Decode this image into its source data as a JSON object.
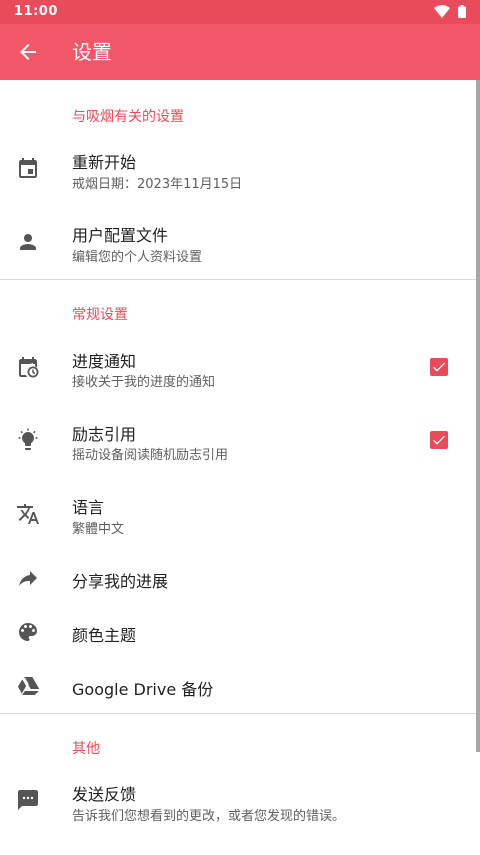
{
  "status_bar": {
    "time": "11:00"
  },
  "app_bar": {
    "title": "设置"
  },
  "colors": {
    "accent": "#e84c5a",
    "toolbar": "#f25767",
    "status_bar": "#e84c5a"
  },
  "sections": {
    "smoking": {
      "header": "与吸烟有关的设置",
      "restart": {
        "title": "重新开始",
        "subtitle": "戒烟日期：2023年11月15日",
        "icon": "calendar-icon"
      },
      "profile": {
        "title": "用户配置文件",
        "subtitle": "编辑您的个人资料设置",
        "icon": "person-icon"
      }
    },
    "general": {
      "header": "常规设置",
      "progress_notification": {
        "title": "进度通知",
        "subtitle": "接收关于我的进度的通知",
        "checked": true,
        "icon": "calendar-clock-icon"
      },
      "motivational_quotes": {
        "title": "励志引用",
        "subtitle": "摇动设备阅读随机励志引用",
        "checked": true,
        "icon": "lightbulb-icon"
      },
      "language": {
        "title": "语言",
        "subtitle": "繁體中文",
        "icon": "translate-icon"
      },
      "share": {
        "title": "分享我的进展",
        "icon": "share-icon"
      },
      "theme": {
        "title": "颜色主题",
        "icon": "palette-icon"
      },
      "backup": {
        "title": "Google Drive 备份",
        "icon": "google-drive-icon"
      }
    },
    "other": {
      "header": "其他",
      "feedback": {
        "title": "发送反馈",
        "subtitle": "告诉我们您想看到的更改，或者您发现的错误。",
        "icon": "feedback-icon"
      }
    }
  }
}
